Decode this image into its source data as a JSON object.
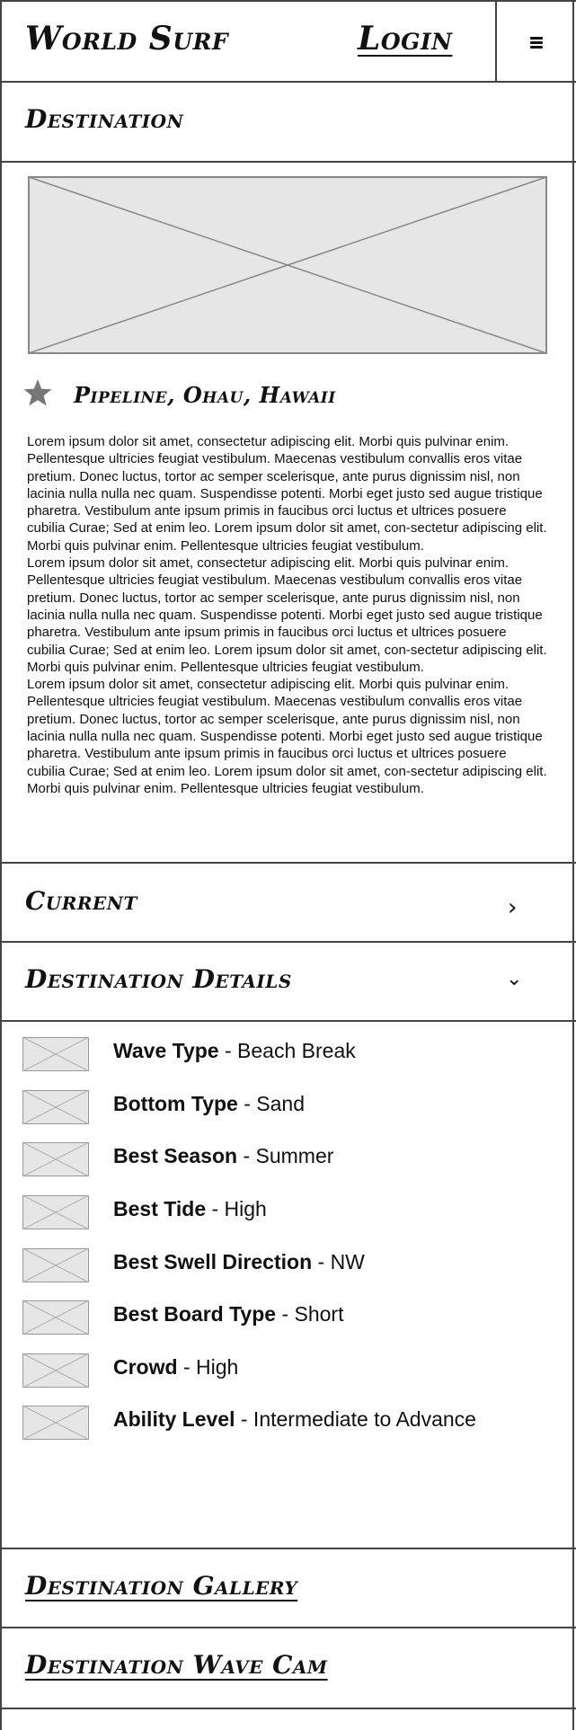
{
  "header": {
    "brand": "World Surf",
    "login_label": "Login",
    "menu_icon": "hamburger-menu-icon"
  },
  "section": {
    "title": "Destination"
  },
  "spot": {
    "favorite_icon": "star-icon",
    "name": "Pipeline, Ohau, Hawaii",
    "paragraphs": [
      "Lorem ipsum dolor sit amet, consectetur adipiscing elit. Morbi quis pulvinar enim. Pellentesque ultricies feugiat vestibulum. Maecenas vestibulum convallis eros vitae pretium. Donec luctus, tortor ac semper scelerisque, ante purus dignissim nisl, non lacinia nulla nulla nec quam. Suspendisse potenti. Morbi eget justo sed augue tristique pharetra. Vestibulum ante ipsum primis in faucibus orci luctus et ultrices posuere cubilia Curae; Sed at enim leo. Lorem ipsum dolor sit amet, con-sectetur adipiscing elit. Morbi quis pulvinar enim. Pellentesque ultricies feugiat vestibulum.",
      "Lorem ipsum dolor sit amet, consectetur adipiscing elit. Morbi quis pulvinar enim. Pellentesque ultricies feugiat vestibulum. Maecenas vestibulum convallis eros vitae pretium. Donec luctus, tortor ac semper scelerisque, ante purus dignissim nisl, non lacinia nulla nulla nec quam. Suspendisse potenti. Morbi eget justo sed augue tristique pharetra. Vestibulum ante ipsum primis in faucibus orci luctus et ultrices posuere cubilia Curae; Sed at enim leo. Lorem ipsum dolor sit amet, con-sectetur adipiscing elit. Morbi quis pulvinar enim. Pellentesque ultricies feugiat vestibulum.",
      "Lorem ipsum dolor sit amet, consectetur adipiscing elit. Morbi quis pulvinar enim. Pellentesque ultricies feugiat vestibulum. Maecenas vestibulum convallis eros vitae pretium. Donec luctus, tortor ac semper scelerisque, ante purus dignissim nisl, non lacinia nulla nulla nec quam. Suspendisse potenti. Morbi eget justo sed augue tristique pharetra. Vestibulum ante ipsum primis in faucibus orci luctus et ultrices posuere cubilia Curae; Sed at enim leo. Lorem ipsum dolor sit amet, con-sectetur adipiscing elit. Morbi quis pulvinar enim. Pellentesque ultricies feugiat vestibulum."
    ]
  },
  "accordion": {
    "current_label": "Current",
    "current_icon": "chevron-right-icon",
    "details_label": "Destination Details",
    "details_icon": "chevron-down-icon"
  },
  "details": [
    {
      "label": "Wave Type",
      "value": "- Beach Break"
    },
    {
      "label": "Bottom Type",
      "value": "- Sand"
    },
    {
      "label": "Best Season",
      "value": "- Summer"
    },
    {
      "label": "Best Tide",
      "value": "- High"
    },
    {
      "label": "Best Swell Direction",
      "value": "- NW"
    },
    {
      "label": "Best Board Type",
      "value": "- Short"
    },
    {
      "label": "Crowd",
      "value": "- High"
    },
    {
      "label": "Ability Level",
      "value": "- Intermediate to Advance"
    }
  ],
  "links": {
    "gallery": "Destination Gallery",
    "wave_cam": "Destination Wave Cam"
  },
  "colors": {
    "border": "#444444",
    "placeholder_fill": "#e6e6e6",
    "placeholder_stroke": "#888888",
    "star": "#777777"
  }
}
